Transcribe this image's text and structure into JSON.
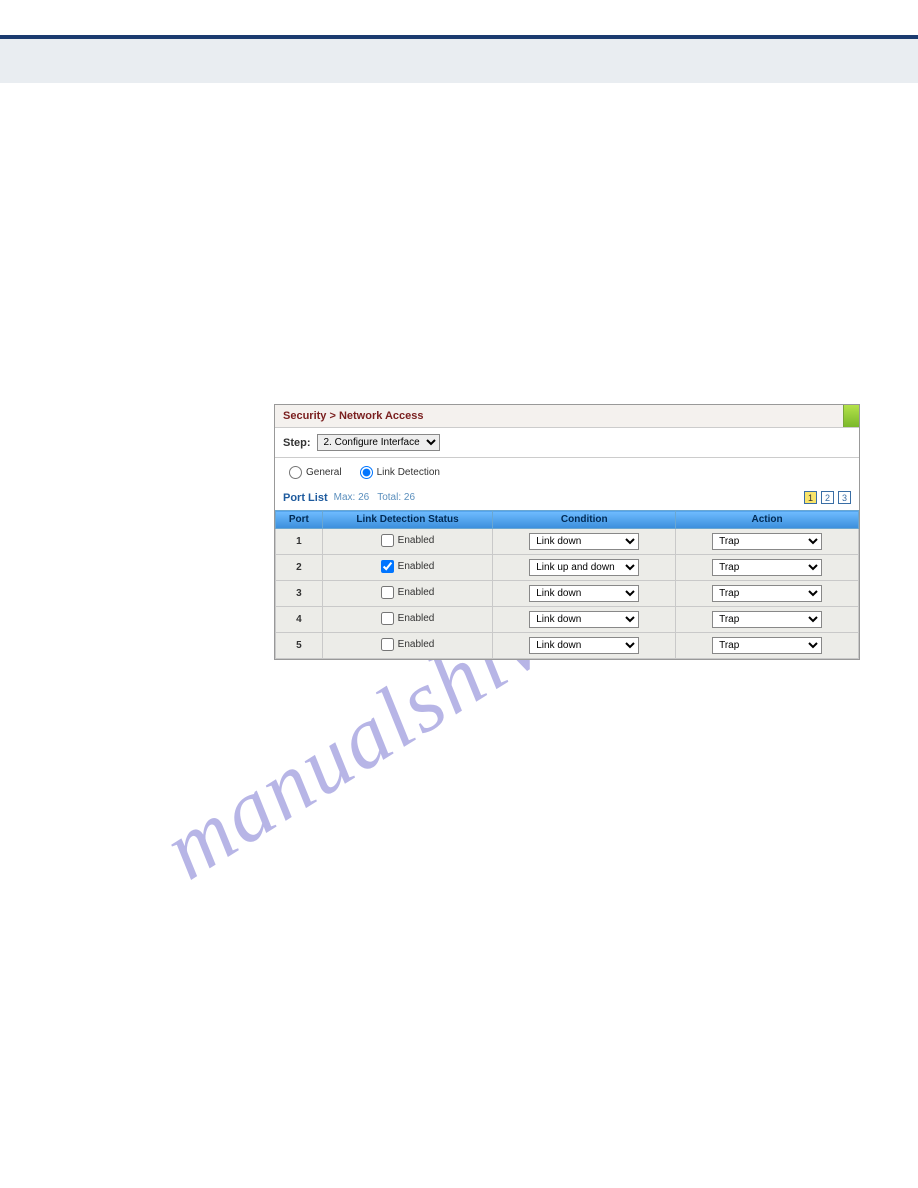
{
  "page": {
    "watermark": "manualshive.com"
  },
  "panel": {
    "breadcrumb": "Security > Network Access",
    "step_label": "Step:",
    "step_value": "2. Configure Interface",
    "tabs": {
      "general": "General",
      "link_detection": "Link Detection",
      "selected": "link_detection"
    },
    "list": {
      "title": "Port List",
      "max_label": "Max: 26",
      "total_label": "Total: 26",
      "pages": [
        "1",
        "2",
        "3"
      ],
      "active_page": "1",
      "columns": {
        "port": "Port",
        "status": "Link Detection Status",
        "condition": "Condition",
        "action": "Action"
      },
      "checkbox_label": "Enabled",
      "rows": [
        {
          "port": "1",
          "enabled": false,
          "condition": "Link down",
          "action": "Trap"
        },
        {
          "port": "2",
          "enabled": true,
          "condition": "Link up and down",
          "action": "Trap"
        },
        {
          "port": "3",
          "enabled": false,
          "condition": "Link down",
          "action": "Trap"
        },
        {
          "port": "4",
          "enabled": false,
          "condition": "Link down",
          "action": "Trap"
        },
        {
          "port": "5",
          "enabled": false,
          "condition": "Link down",
          "action": "Trap"
        }
      ]
    }
  }
}
